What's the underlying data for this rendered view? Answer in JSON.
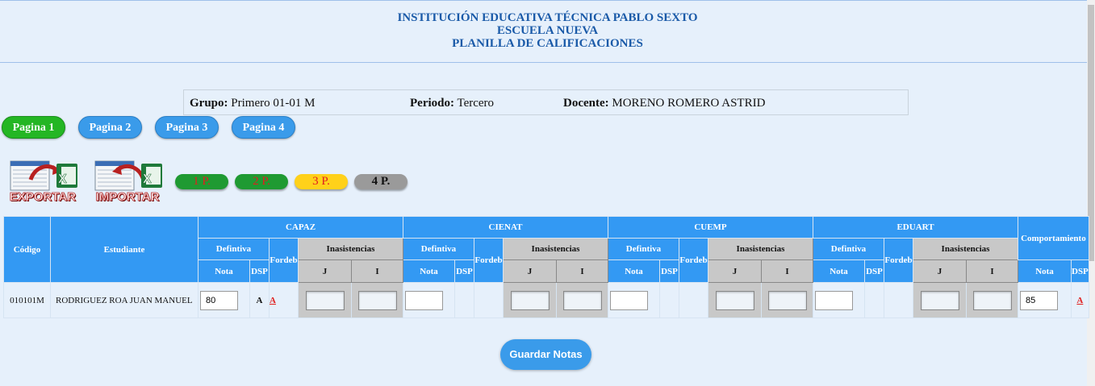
{
  "header": {
    "line1": "INSTITUCIÓN EDUCATIVA TÉCNICA PABLO SEXTO",
    "line2": "ESCUELA NUEVA",
    "line3": "PLANILLA DE CALIFICACIONES"
  },
  "info": {
    "grupo_label": "Grupo:",
    "grupo_value": "Primero 01-01 M",
    "periodo_label": "Periodo:",
    "periodo_value": "Tercero",
    "docente_label": "Docente:",
    "docente_value": "MORENO ROMERO ASTRID"
  },
  "pages": [
    "Pagina 1",
    "Pagina 2",
    "Pagina 3",
    "Pagina 4"
  ],
  "active_page": "Pagina 1",
  "excel_buttons": {
    "export_label": "EXPORTAR",
    "import_label": "IMPORTAR"
  },
  "periods": [
    "1 P.",
    "2 P.",
    "3 P.",
    "4 P."
  ],
  "table": {
    "codigo_header": "Código",
    "estudiante_header": "Estudiante",
    "subjects": [
      "CAPAZ",
      "CIENAT",
      "CUEMP",
      "EDUART"
    ],
    "definitiva_header": "Defintiva",
    "fordeb_header": "Fordeb",
    "inasistencias_header": "Inasistencias",
    "nota_header": "Nota",
    "dsp_header": "DSP",
    "j_header": "J",
    "i_header": "I",
    "comportamiento_header": "Comportamiento",
    "rows": [
      {
        "codigo": "010101M",
        "estudiante": "RODRIGUEZ ROA JUAN MANUEL",
        "capaz_nota": "80",
        "capaz_desempeno": "A",
        "capaz_dsp_link": "A",
        "cienat_nota": "",
        "cuemp_nota": "",
        "eduart_nota": "",
        "comportamiento_nota": "85",
        "comportamiento_dsp_link": "A"
      }
    ]
  },
  "save_button": "Guardar Notas",
  "colors": {
    "background": "#e6f0fb",
    "header_text": "#1a5aa8",
    "table_header": "#3399f3",
    "active_page": "#24b624",
    "page_button": "#3a9bea",
    "link_red": "#e02020"
  }
}
